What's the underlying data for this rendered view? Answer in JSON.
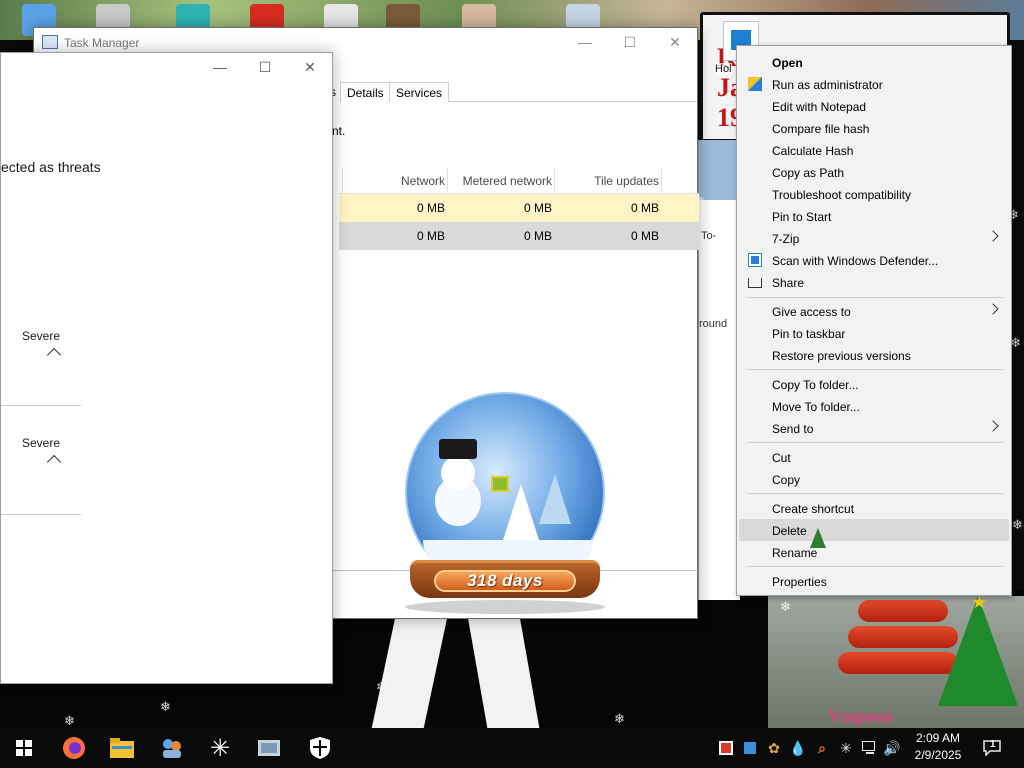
{
  "task_manager": {
    "title": "Task Manager",
    "tabs": [
      "s",
      "Details",
      "Services"
    ],
    "message_fragment": "nt.",
    "columns": [
      "Network",
      "Metered network",
      "Tile updates"
    ],
    "rows": [
      [
        "0 MB",
        "0 MB",
        "0 MB"
      ],
      [
        "0 MB",
        "0 MB",
        "0 MB"
      ]
    ]
  },
  "defender": {
    "threat_text": "ected as threats",
    "severity_1": "Severe",
    "severity_2": "Severe"
  },
  "snow_globe": {
    "days_label": "318 days"
  },
  "desktop": {
    "poster_text": "K    in Peace\nJa\n19",
    "poster_icon_label": "Hol",
    "window_todo": "To-",
    "window_round": "round",
    "xmas_sign": "Vmpooo"
  },
  "context_menu": {
    "items": [
      {
        "label": "Open",
        "bold": true
      },
      {
        "label": "Run as administrator",
        "icon": "shield-icon"
      },
      {
        "label": "Edit with Notepad"
      },
      {
        "label": "Compare file hash"
      },
      {
        "label": "Calculate Hash"
      },
      {
        "label": "Copy as Path"
      },
      {
        "label": "Troubleshoot compatibility"
      },
      {
        "label": "Pin to Start"
      },
      {
        "label": "7-Zip",
        "submenu": true
      },
      {
        "label": "Scan with Windows Defender...",
        "icon": "defender-icon"
      },
      {
        "label": "Share",
        "icon": "share-icon"
      },
      {
        "label": "Give access to",
        "submenu": true
      },
      {
        "label": "Pin to taskbar"
      },
      {
        "label": "Restore previous versions"
      },
      {
        "label": "Copy To folder..."
      },
      {
        "label": "Move To folder..."
      },
      {
        "label": "Send to",
        "submenu": true
      },
      {
        "label": "Cut"
      },
      {
        "label": "Copy"
      },
      {
        "label": "Create shortcut"
      },
      {
        "label": "Delete",
        "hover": true
      },
      {
        "label": "Rename"
      },
      {
        "label": "Properties"
      }
    ]
  },
  "taskbar": {
    "apps": [
      "windows-start-icon",
      "firefox-icon",
      "file-explorer-icon",
      "people-icon",
      "snowflake-app-icon",
      "photos-icon",
      "defender-shield-icon"
    ],
    "tray": [
      "tray-app-icon",
      "tray-blue-icon",
      "tray-settings-icon",
      "tray-drop-icon",
      "tray-search-icon",
      "tray-snow-icon",
      "network-icon",
      "volume-icon"
    ],
    "time": "2:09 AM",
    "date": "2/9/2025",
    "notification_count": "1"
  },
  "colors": {
    "accent_blue": "#1e7fd6",
    "row_highlight": "#fff4c4",
    "row_selected": "#d9d9d9",
    "menu_bg": "#f2f2f2"
  }
}
